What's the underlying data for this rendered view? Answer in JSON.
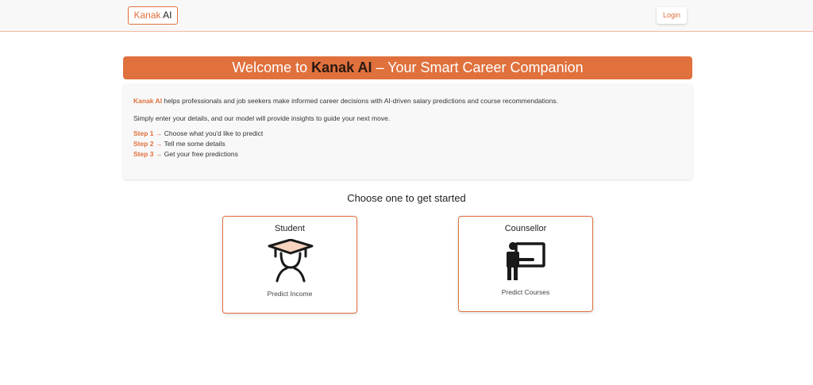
{
  "navbar": {
    "brand_part1": "Kanak",
    "brand_part2": " AI",
    "login_label": "Login"
  },
  "banner": {
    "prefix": "Welcome to ",
    "brand": "Kanak AI",
    "suffix": " – Your Smart Career Companion"
  },
  "info": {
    "brand": "Kanak AI",
    "line1": " helps professionals and job seekers make informed career decisions with AI-driven salary predictions and course recommendations.",
    "line2": "Simply enter your details, and our model will provide insights to guide your next move.",
    "steps": [
      {
        "label": "Step 1",
        "arrow": " → ",
        "text": "Choose what you'd like to predict"
      },
      {
        "label": "Step 2",
        "arrow": " → ",
        "text": "Tell me some details"
      },
      {
        "label": "Step 3",
        "arrow": " → ",
        "text": "Get your free predictions"
      }
    ]
  },
  "choose_heading": "Choose one to get started",
  "options": [
    {
      "title": "Student",
      "subtitle": "Predict Income",
      "icon": "graduation-cap-icon"
    },
    {
      "title": "Counsellor",
      "subtitle": "Predict Courses",
      "icon": "teacher-board-icon"
    }
  ],
  "colors": {
    "accent": "#e0713d",
    "accent_light": "#f8d3c0",
    "dark": "#2a1a12"
  }
}
